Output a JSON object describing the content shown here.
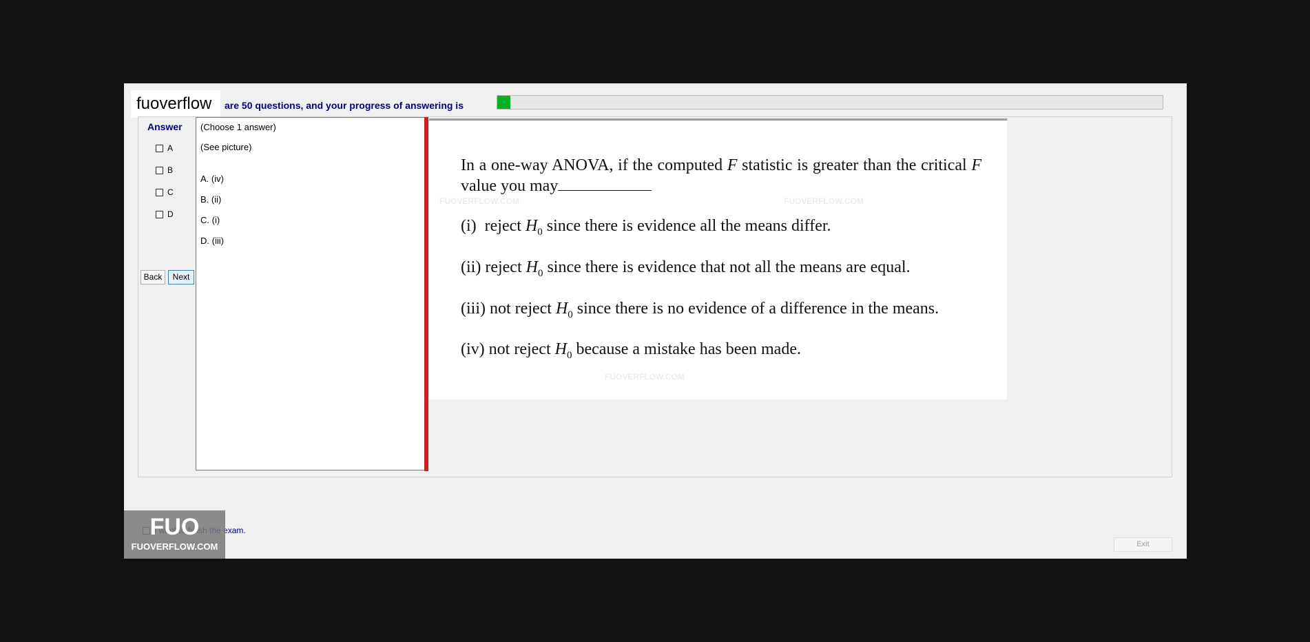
{
  "header": {
    "brand": "fuoverflow",
    "progress_text": "are 50 questions, and your progress of answering is",
    "progress_fraction": 0.02,
    "progress_color": "#06b025"
  },
  "answer_panel": {
    "title": "Answer",
    "options": [
      {
        "label": "A",
        "checked": false
      },
      {
        "label": "B",
        "checked": false
      },
      {
        "label": "C",
        "checked": false
      },
      {
        "label": "D",
        "checked": false
      }
    ],
    "back_label": "Back",
    "next_label": "Next"
  },
  "listbox": {
    "instruction": "(Choose 1 answer)",
    "picture_note": "(See picture)",
    "choices": [
      "A. (iv)",
      "B. (ii)",
      "C. (i)",
      "D. (iii)"
    ]
  },
  "question": {
    "stem_part1": "In a one-way ANOVA, if the computed",
    "stem_var1": "F",
    "stem_part2": "statistic is greater than the critical",
    "stem_var2": "F",
    "stem_part3": "value you  may",
    "options": [
      {
        "num": "(i)",
        "verb": "reject",
        "rest": "since there is evidence all the means differ."
      },
      {
        "num": "(ii)",
        "verb": "reject",
        "rest": "since there is evidence that not all the means are equal."
      },
      {
        "num": "(iii)",
        "verb": "not reject",
        "rest": "since there is no evidence of a difference in the  means."
      },
      {
        "num": "(iv)",
        "verb": "not reject",
        "rest": "because a mistake has been made."
      }
    ],
    "hypothesis": "H",
    "hypothesis_sub": "0"
  },
  "footer": {
    "finish_label": "I want to finish the exam.",
    "exit_label": "Exit"
  },
  "watermark": {
    "logo_big": "FUO",
    "logo_small": "FUOVERFLOW.COM",
    "text": "FUOVERFLOW.COM"
  },
  "colors": {
    "divider": "#cc1f1f",
    "heading_blue": "#000080"
  }
}
